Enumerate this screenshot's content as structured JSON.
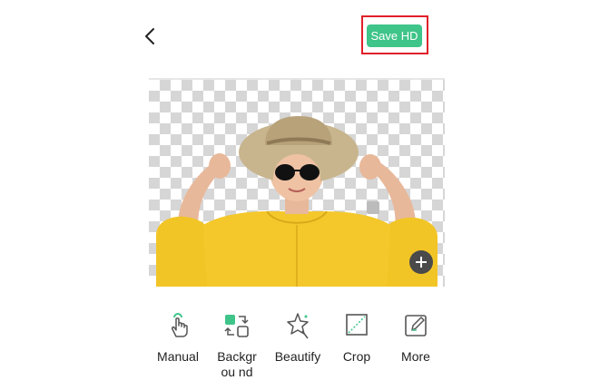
{
  "header": {
    "back_icon": "chevron-left-icon",
    "save_label": "Save HD",
    "save_color": "#3fc489",
    "highlight_color": "#e0202a"
  },
  "canvas": {
    "background": "transparency-checkerboard",
    "add_icon": "plus-icon"
  },
  "toolbar": {
    "accent_color": "#3fc489",
    "items": [
      {
        "label": "Manual",
        "icon": "hand-tap-icon"
      },
      {
        "label": "Backgrou nd",
        "icon": "background-swap-icon"
      },
      {
        "label": "Beautify",
        "icon": "sparkle-star-icon"
      },
      {
        "label": "Crop",
        "icon": "crop-icon"
      },
      {
        "label": "More",
        "icon": "edit-pencil-icon"
      }
    ]
  }
}
